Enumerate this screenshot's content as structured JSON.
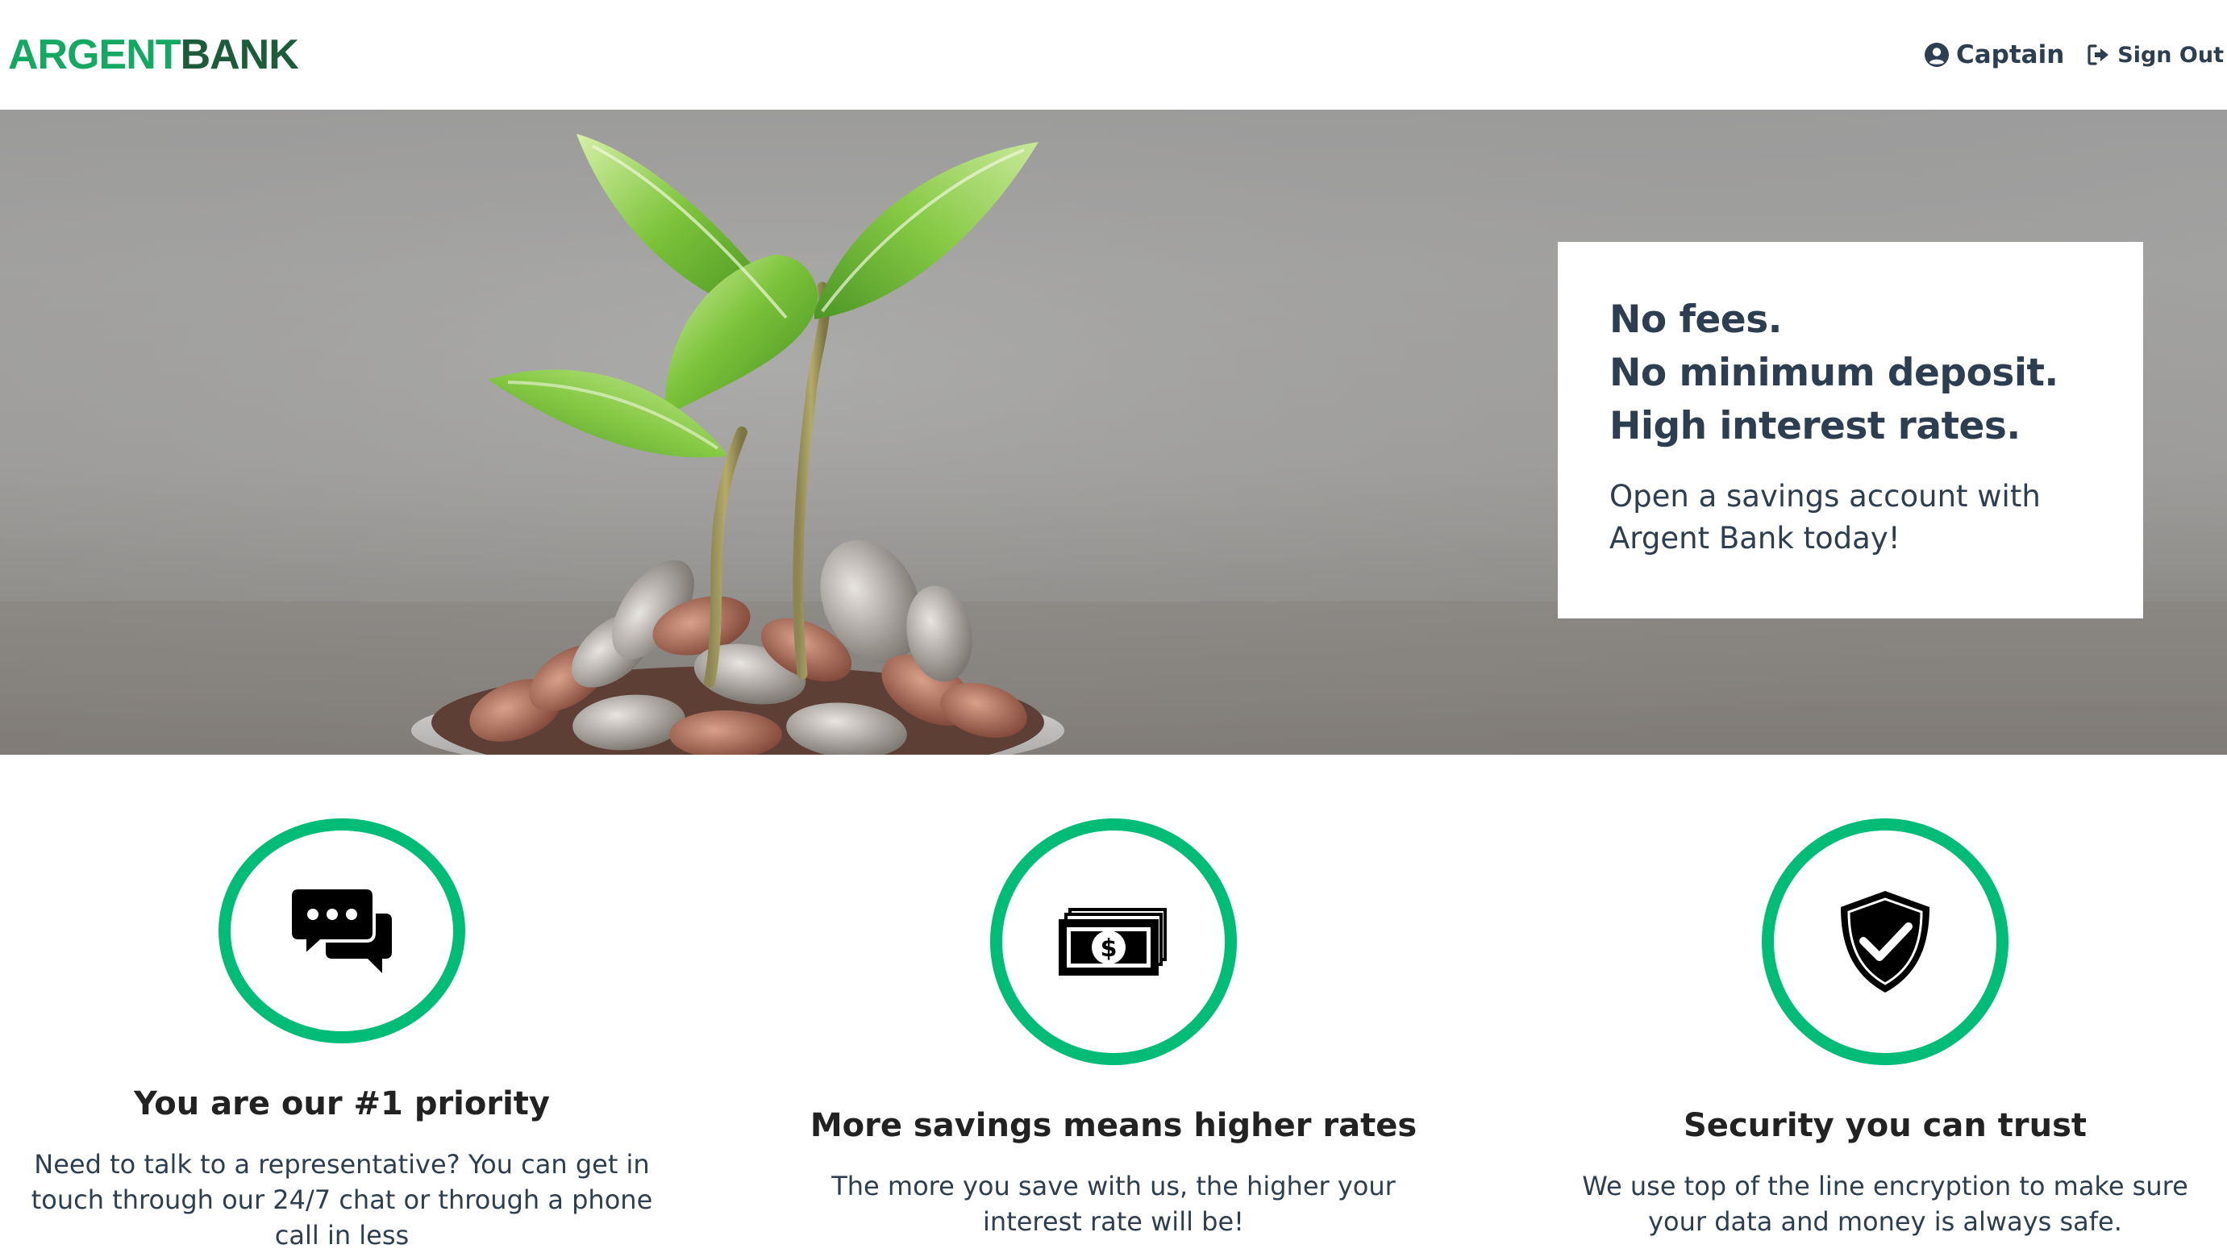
{
  "header": {
    "logo_argent": "ARGENT",
    "logo_bank": "BANK",
    "user_name": "Captain",
    "sign_out_label": "Sign Out",
    "user_icon": "user-circle-icon",
    "sign_out_icon": "sign-out-icon"
  },
  "hero": {
    "image": "plant-growing-from-coins",
    "promo": {
      "lines": [
        "No fees.",
        "No minimum deposit.",
        "High interest rates."
      ],
      "subtitle": "Open a savings account with Argent Bank today!"
    }
  },
  "features": [
    {
      "icon": "chat-icon",
      "title": "You are our #1 priority",
      "text": "Need to talk to a representative? You can get in touch through our 24/7 chat or through a phone call in less"
    },
    {
      "icon": "money-icon",
      "title": "More savings means higher rates",
      "text": "The more you save with us, the higher your interest rate will be!"
    },
    {
      "icon": "security-shield-icon",
      "title": "Security you can trust",
      "text": "We use top of the line encryption to make sure your data and money is always safe."
    }
  ],
  "colors": {
    "brand_green": "#00bc77",
    "logo_green_light": "#14a863",
    "logo_green_dark": "#1d5c3a",
    "text_dark": "#2c3e50"
  }
}
